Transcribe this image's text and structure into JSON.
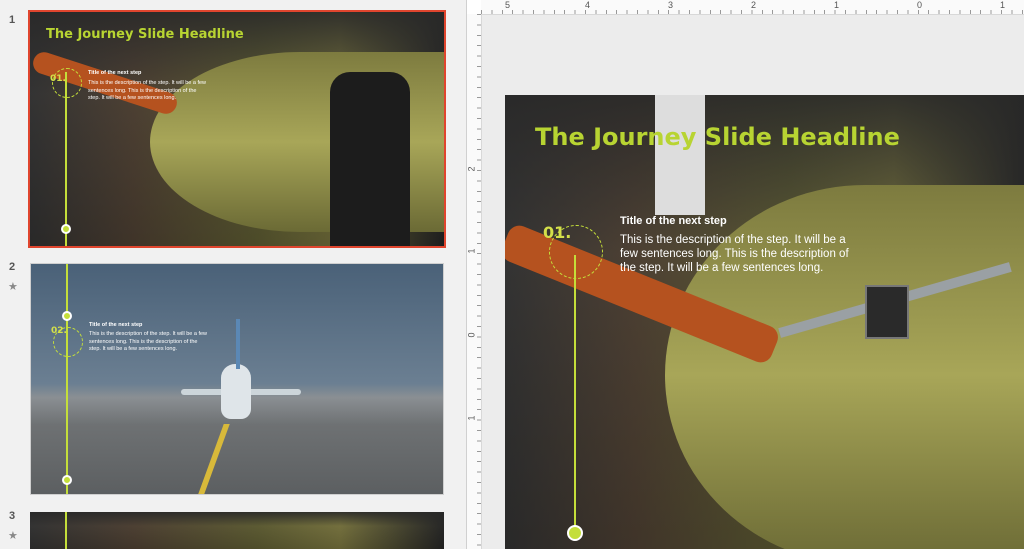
{
  "slides": [
    {
      "number": "1",
      "headline": "The Journey Slide Headline",
      "step_number": "01.",
      "step_title": "Title of the next step",
      "step_description": "This is the description of the step. It will be a few sentences long. This is the description of the step. It will be a few sentences long."
    },
    {
      "number": "2",
      "star": "★",
      "step_number": "02.",
      "step_title": "Title of the next step",
      "step_description": "This is the description of the step. It will be a few sentences long. This is the description of the step. It will be a few sentences long."
    },
    {
      "number": "3",
      "star": "★"
    }
  ],
  "main_slide": {
    "headline": "The Journey Slide Headline",
    "step_number": "01.",
    "step_title": "Title of the next step",
    "step_description": "This is the description of the step. It will be a few sentences long. This is the description of the step. It will be a few sentences long."
  },
  "ruler": {
    "horizontal": [
      "5",
      "4",
      "3",
      "2",
      "1",
      "0",
      "1"
    ],
    "vertical": [
      "2",
      "1",
      "0",
      "1"
    ]
  },
  "colors": {
    "accent": "#b8d432",
    "selection": "#e0452e"
  }
}
